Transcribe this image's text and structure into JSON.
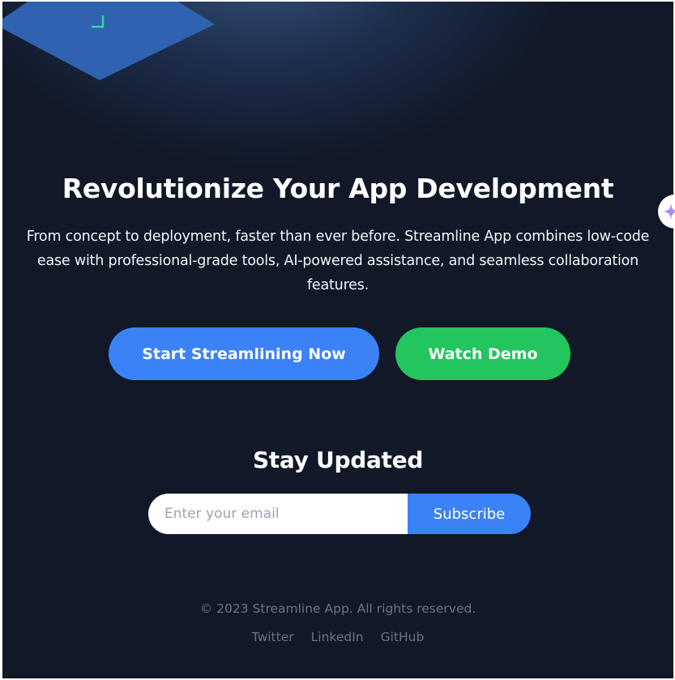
{
  "hero": {
    "title": "Revolutionize Your App Development",
    "subtitle": "From concept to deployment, faster than ever before. Streamline App combines low-code ease with professional-grade tools, AI-powered assistance, and seamless collaboration features.",
    "primary_cta": "Start Streamlining Now",
    "secondary_cta": "Watch Demo"
  },
  "newsletter": {
    "title": "Stay Updated",
    "email_placeholder": "Enter your email",
    "email_value": "",
    "subscribe_label": "Subscribe"
  },
  "footer": {
    "copyright": "© 2023 Streamline App. All rights reserved.",
    "links": [
      "Twitter",
      "LinkedIn",
      "GitHub"
    ]
  },
  "decor": {
    "diamond_icon": "bracket-corner-icon",
    "assistant_icon": "sparkle-icon"
  },
  "colors": {
    "background": "#111827",
    "primary": "#3b82f6",
    "success": "#22c55e",
    "diamond": "#2f62b0",
    "bracket": "#34d399",
    "sparkle": "#a78bfa"
  }
}
